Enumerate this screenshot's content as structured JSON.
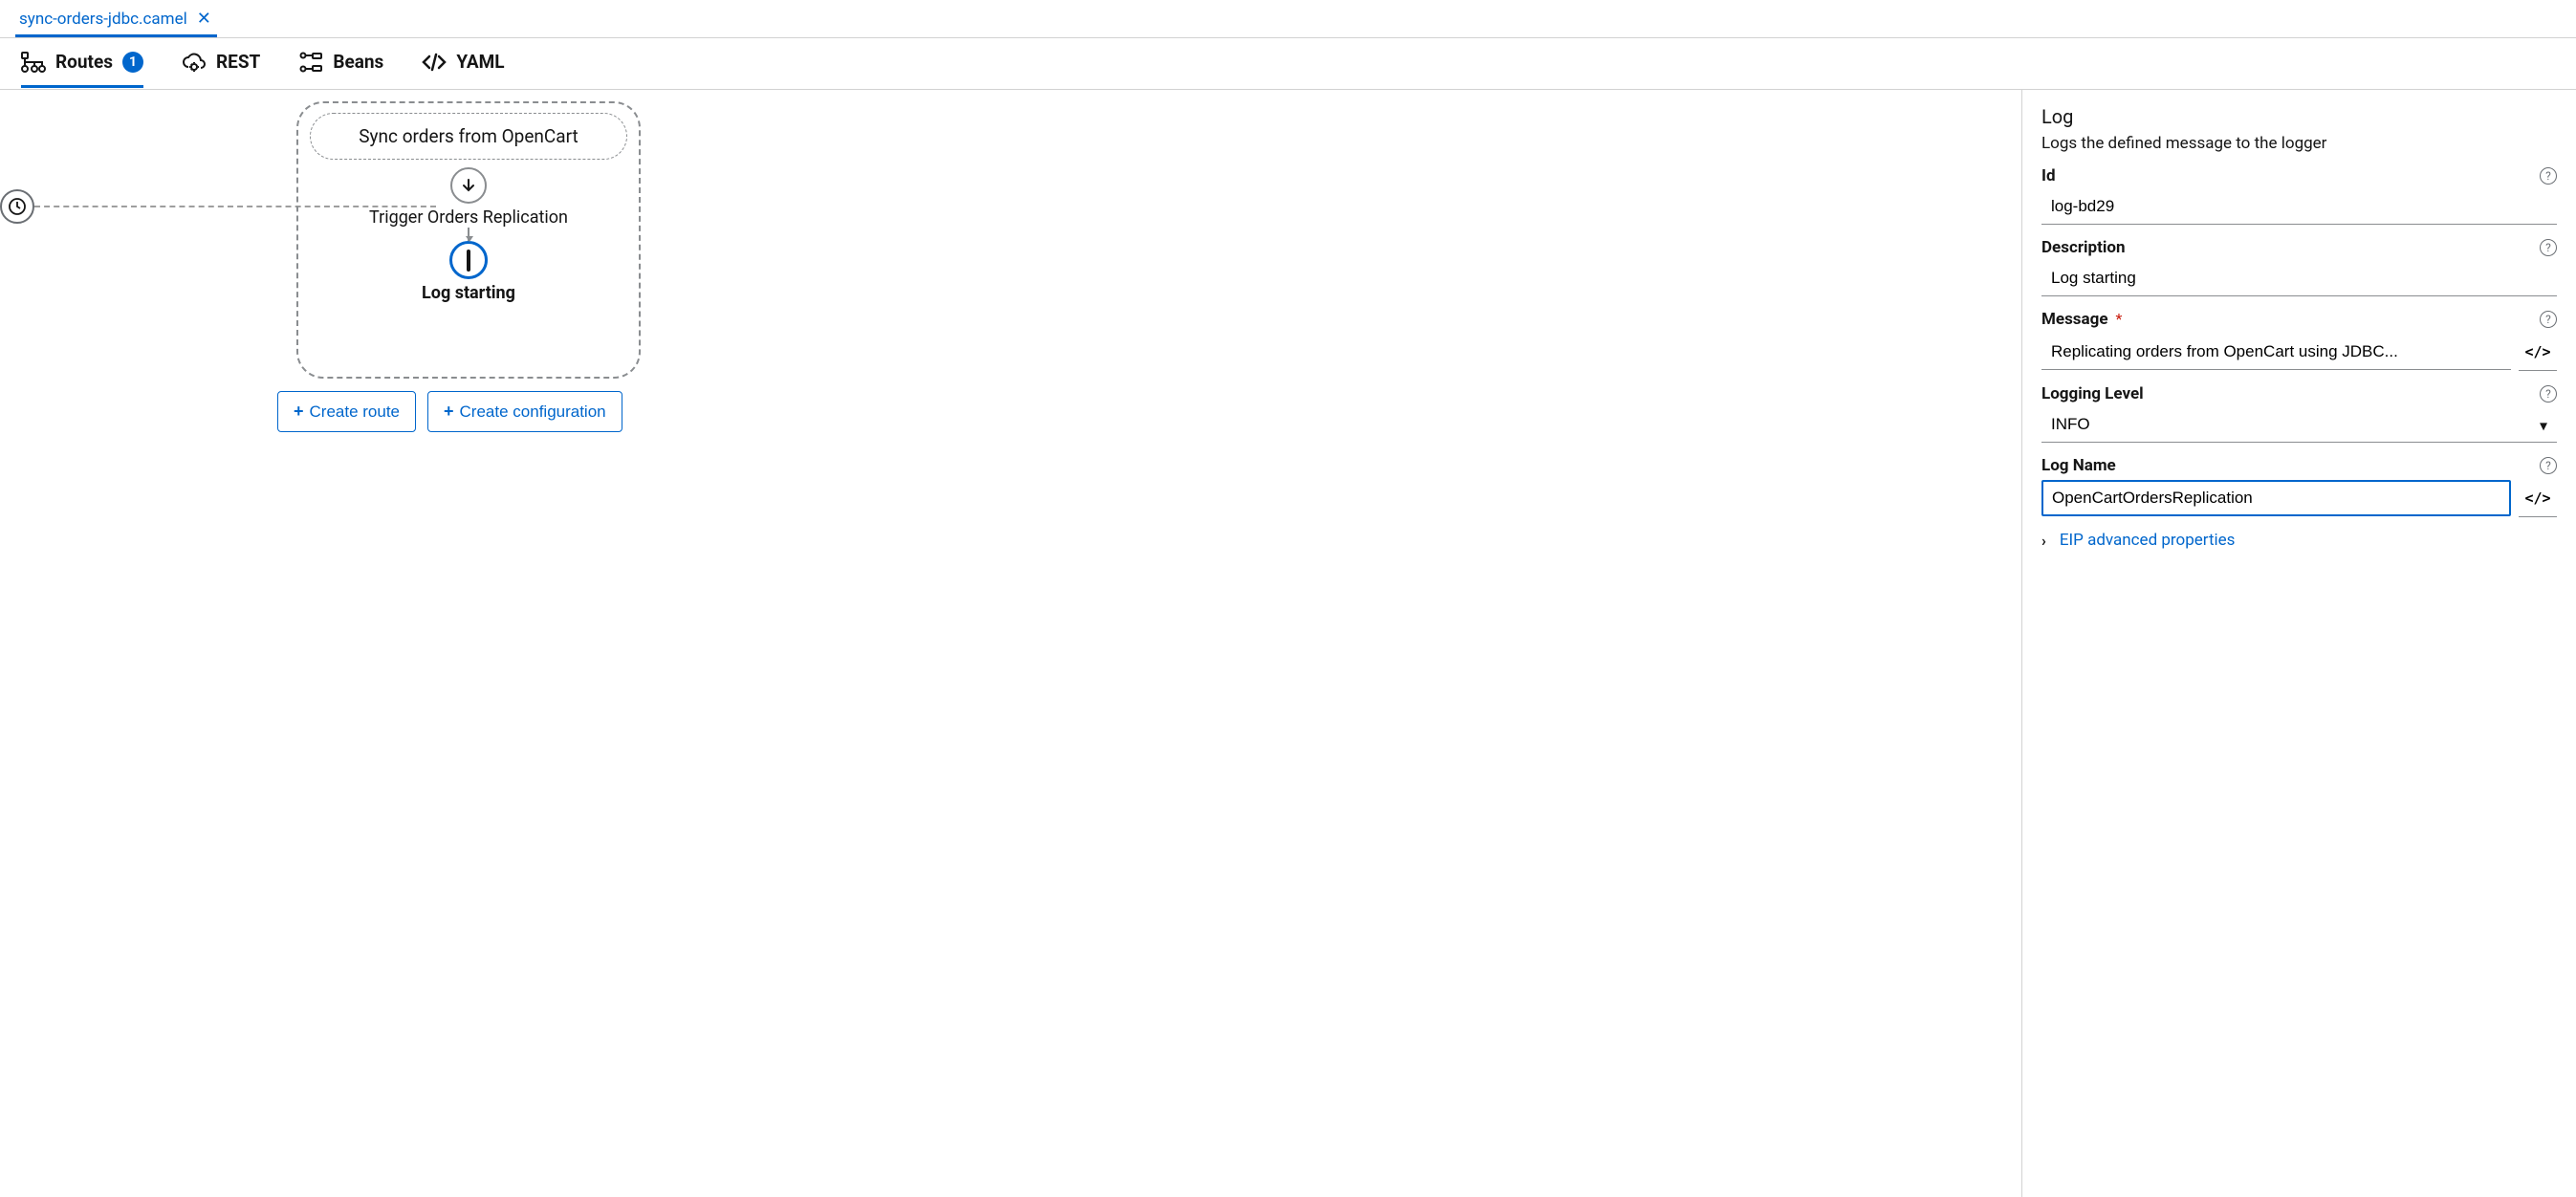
{
  "fileTab": {
    "name": "sync-orders-jdbc.camel"
  },
  "viewTabs": {
    "routes": {
      "label": "Routes",
      "count": "1"
    },
    "rest": {
      "label": "REST"
    },
    "beans": {
      "label": "Beans"
    },
    "yaml": {
      "label": "YAML"
    }
  },
  "canvas": {
    "routeTitle": "Sync orders from OpenCart",
    "triggerLabel": "Trigger Orders Replication",
    "logLabel": "Log starting",
    "createRoute": "Create route",
    "createConfig": "Create configuration"
  },
  "props": {
    "stepTitle": "Log",
    "stepDesc": "Logs the defined message to the logger",
    "idLabel": "Id",
    "idValue": "log-bd29",
    "descLabel": "Description",
    "descValue": "Log starting",
    "msgLabel": "Message",
    "msgValue": "Replicating orders from OpenCart using JDBC...",
    "levelLabel": "Logging Level",
    "levelValue": "INFO",
    "logNameLabel": "Log Name",
    "logNameValue": "OpenCartOrdersReplication",
    "advancedLabel": "EIP advanced properties"
  }
}
